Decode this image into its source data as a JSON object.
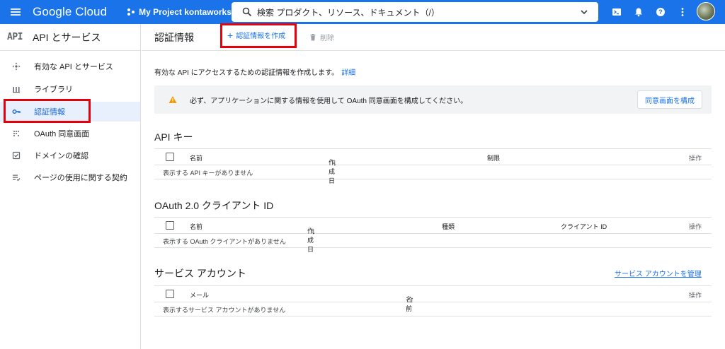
{
  "topbar": {
    "brand": "Google Cloud",
    "project": "My Project kontaworks",
    "search_text": "検索  プロダクト、リソース、ドキュメント（/）",
    "icons": [
      "menu-icon",
      "project-dots-icon",
      "search-icon",
      "terminal-icon",
      "bell-icon",
      "help-icon",
      "more-vert-icon"
    ]
  },
  "sidebar": {
    "logo": "API",
    "title": "API とサービス",
    "items": [
      {
        "label": "有効な API とサービス",
        "icon": "services-icon"
      },
      {
        "label": "ライブラリ",
        "icon": "library-icon"
      },
      {
        "label": "認証情報",
        "icon": "key-icon",
        "active": true
      },
      {
        "label": "OAuth 同意画面",
        "icon": "oauth-icon"
      },
      {
        "label": "ドメインの確認",
        "icon": "domain-check-icon"
      },
      {
        "label": "ページの使用に関する契約",
        "icon": "agreement-icon"
      }
    ]
  },
  "main": {
    "title": "認証情報",
    "create_label": "認証情報を作成",
    "delete_label": "削除",
    "intro_text": "有効な API にアクセスするための認証情報を作成します。",
    "intro_link": "詳細",
    "warning_text": "必ず、アプリケーションに関する情報を使用して OAuth 同意画面を構成してください。",
    "warning_button": "同意画面を構成",
    "api_keys": {
      "title": "API キー",
      "columns": [
        "名前",
        "作成日",
        "制限",
        "操作"
      ],
      "empty": "表示する API キーがありません"
    },
    "oauth_clients": {
      "title": "OAuth 2.0 クライアント ID",
      "columns": [
        "名前",
        "作成日",
        "種類",
        "クライアント ID",
        "操作"
      ],
      "empty": "表示する OAuth クライアントがありません"
    },
    "service_accounts": {
      "title": "サービス アカウント",
      "manage_link": "サービス アカウントを管理",
      "columns": [
        "メール",
        "名前",
        "操作"
      ],
      "empty": "表示するサービス アカウントがありません"
    }
  },
  "colors": {
    "topbar": "#1a73e8",
    "active_bg": "#e8f0fe",
    "highlight_box": "#e8000b",
    "warning": "#f29900"
  }
}
